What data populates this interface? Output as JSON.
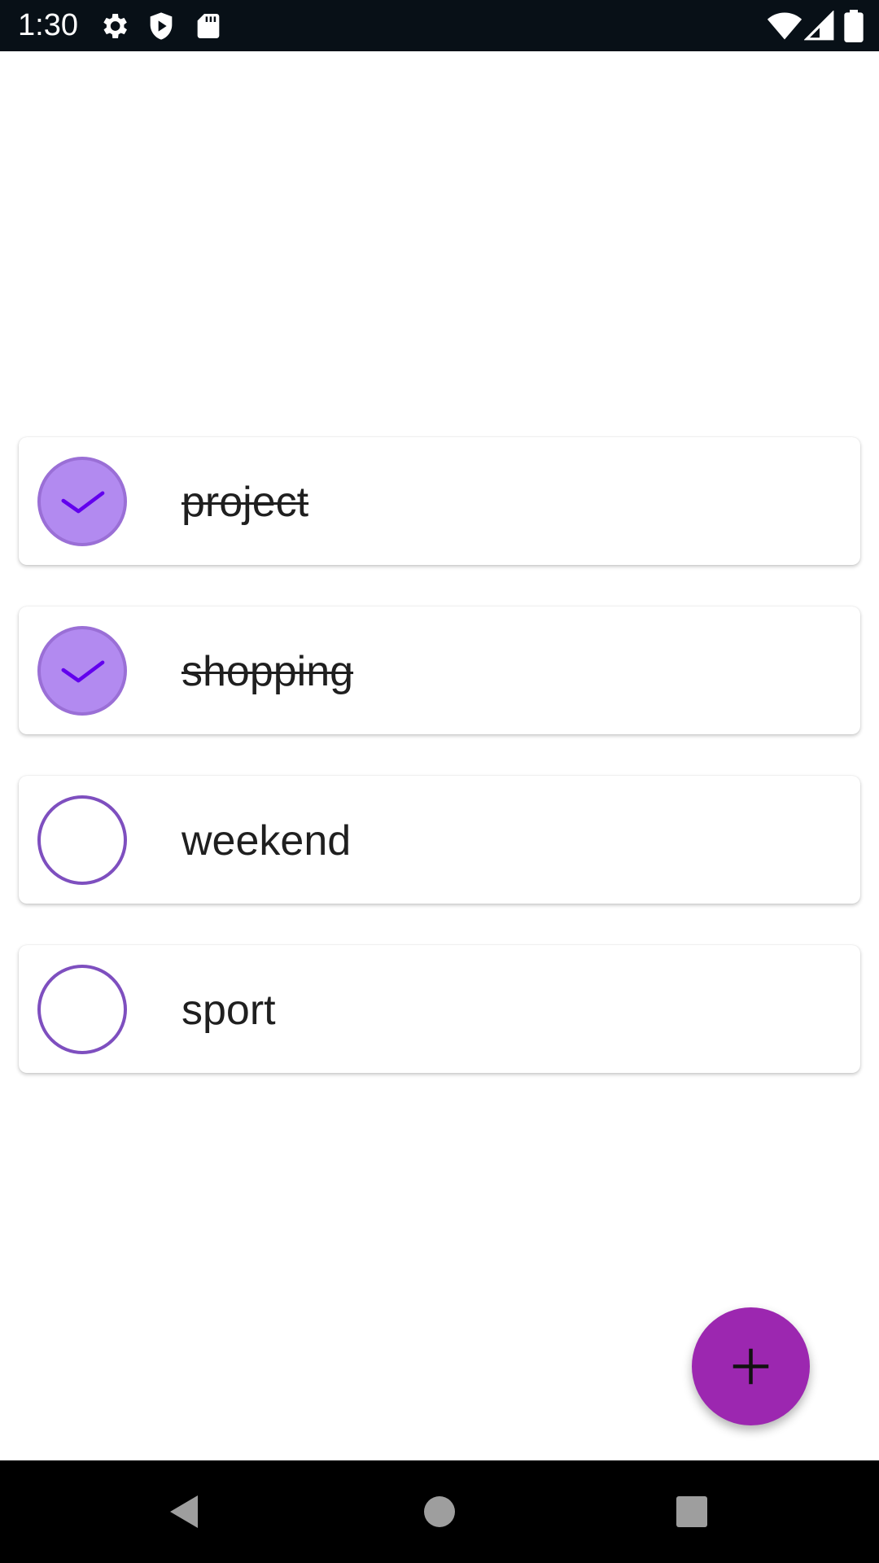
{
  "status_bar": {
    "time": "1:30",
    "left_icons": [
      "settings-icon",
      "shield-icon",
      "sd-card-icon"
    ],
    "right_icons": [
      "wifi-icon",
      "signal-icon",
      "battery-icon"
    ]
  },
  "tasks": [
    {
      "label": "project",
      "completed": true
    },
    {
      "label": "shopping",
      "completed": true
    },
    {
      "label": "weekend",
      "completed": false
    },
    {
      "label": "sport",
      "completed": false
    }
  ],
  "fab": {
    "icon": "plus-icon"
  },
  "nav_bar": {
    "buttons": [
      "back-icon",
      "home-icon",
      "recents-icon"
    ]
  },
  "colors": {
    "accent": "#9c27b0",
    "checked_fill": "#b28af0",
    "checkmark": "#6200ee",
    "unchecked_ring": "#7e4fbf"
  }
}
